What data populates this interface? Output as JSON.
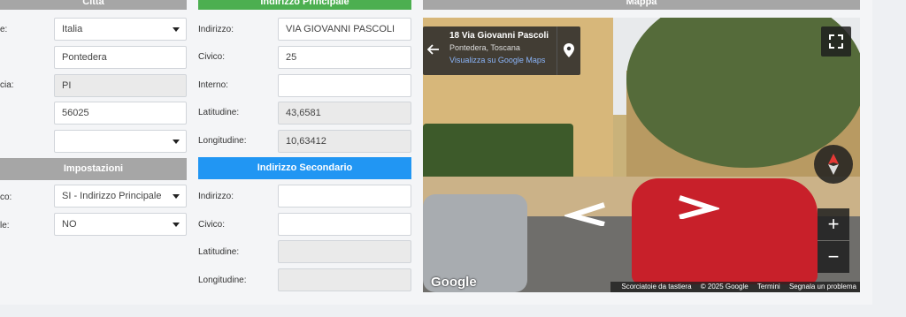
{
  "citta": {
    "header": "Città",
    "labels": [
      "e:",
      "",
      "cia:",
      "",
      ""
    ],
    "fields": [
      {
        "value": "Italia",
        "type": "select"
      },
      {
        "value": "Pontedera",
        "type": "text"
      },
      {
        "value": "PI",
        "type": "readonly"
      },
      {
        "value": "56025",
        "type": "text"
      },
      {
        "value": "",
        "type": "select"
      }
    ]
  },
  "impostazioni": {
    "header": "Impostazioni",
    "labels": [
      "co:",
      "le:"
    ],
    "fields": [
      {
        "value": "SI - Indirizzo Principale",
        "type": "select"
      },
      {
        "value": "NO",
        "type": "select"
      }
    ]
  },
  "principale": {
    "header": "Indirizzo Principale",
    "labels": [
      "Indirizzo:",
      "Civico:",
      "Interno:",
      "Latitudine:",
      "Longitudine:"
    ],
    "fields": [
      {
        "value": "VIA GIOVANNI PASCOLI",
        "type": "text"
      },
      {
        "value": "25",
        "type": "text"
      },
      {
        "value": "",
        "type": "text"
      },
      {
        "value": "43,6581",
        "type": "readonly"
      },
      {
        "value": "10,63412",
        "type": "readonly"
      }
    ]
  },
  "secondario": {
    "header": "Indirizzo Secondario",
    "labels": [
      "Indirizzo:",
      "Civico:",
      "Latitudine:",
      "Longitudine:"
    ],
    "fields": [
      {
        "value": "",
        "type": "text"
      },
      {
        "value": "",
        "type": "text"
      },
      {
        "value": "",
        "type": "readonly"
      },
      {
        "value": "",
        "type": "readonly"
      }
    ]
  },
  "mappa": {
    "header": "Mappa",
    "address_title": "18 Via Giovanni Pascoli",
    "address_city": "Pontedera, Toscana",
    "maps_link": "Visualizza su Google Maps",
    "google_logo": "Google",
    "footer": [
      "Scorciatoie da tastiera",
      "© 2025 Google",
      "Termini",
      "Segnala un problema"
    ],
    "zoom_in": "+",
    "zoom_out": "−",
    "icons": [
      "back-arrow-icon",
      "location-pin-icon",
      "fullscreen-icon",
      "compass-icon"
    ]
  }
}
